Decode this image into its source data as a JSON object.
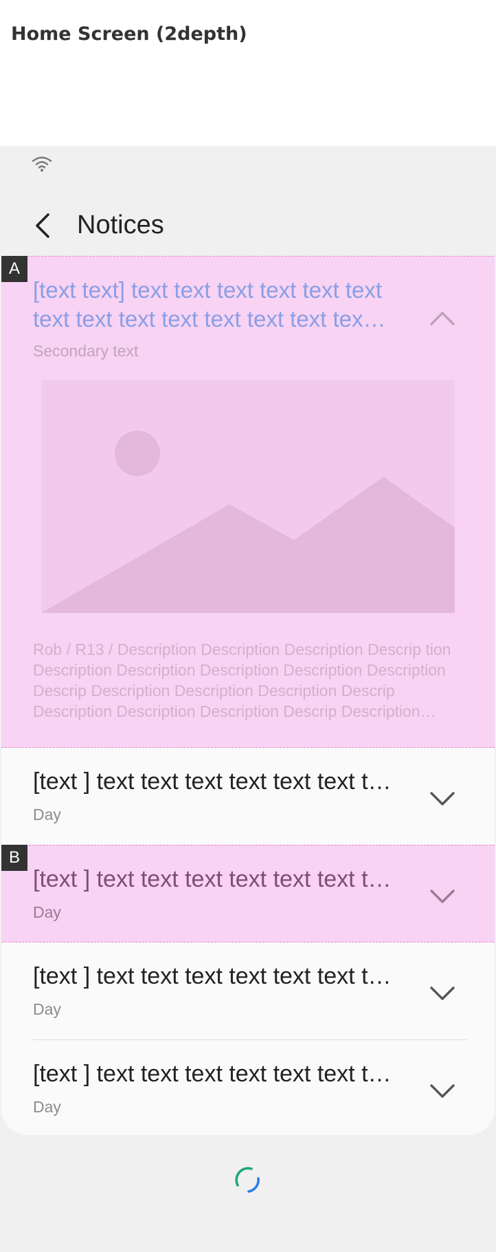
{
  "page": {
    "title": "Home Screen (2depth)"
  },
  "appbar": {
    "title": "Notices"
  },
  "annotations": [
    "A",
    "B"
  ],
  "expanded_item": {
    "title": "[text text] text text text text text text text text text text text text text text text",
    "secondary": "Secondary text",
    "description": "Rob / R13 / Description Description Description Descrip tion Description Description Description Description Description Descrip Description Description Description Descrip Description Description Description Descrip Description Description Description Description"
  },
  "items": [
    {
      "title": "[text ] text text text text text text text text",
      "sub": "Day"
    },
    {
      "title": "[text ] text text text text text text text text",
      "sub": "Day"
    },
    {
      "title": "[text ] text text text text text text text text",
      "sub": "Day"
    },
    {
      "title": "[text ] text text text text text text text text",
      "sub": "Day"
    }
  ],
  "colors": {
    "highlight": "#f8d3f3",
    "expanded_title": "#8a9ee6",
    "spinner_green": "#1fa87a",
    "spinner_blue": "#2b7de9"
  },
  "icons": [
    "wifi-icon",
    "back-arrow-icon",
    "chevron-up-icon",
    "chevron-down-icon",
    "image-placeholder-icon",
    "loading-spinner-icon"
  ]
}
